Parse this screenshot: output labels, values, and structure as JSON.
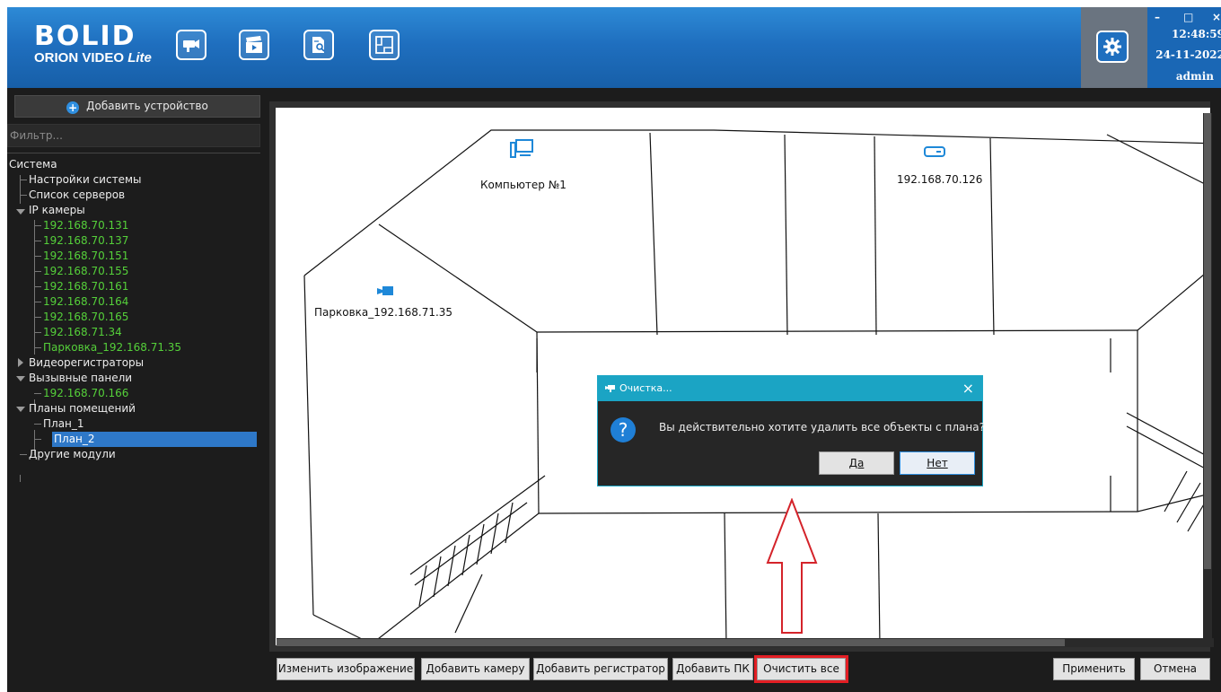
{
  "header": {
    "logo_brand": "BOLID",
    "logo_product": "ORION VIDEO",
    "logo_edition": "Lite",
    "toolbar_icons": [
      "video-camera-icon",
      "playback-clapper-icon",
      "document-search-icon",
      "floor-plan-icon"
    ],
    "settings_icon": "gear-icon",
    "window_controls": {
      "minimize": "–",
      "maximize": "□",
      "close": "×"
    },
    "time": "12:48:59",
    "date": "24-11-2022",
    "user": "admin",
    "accent": "#1f6fbf"
  },
  "sidebar": {
    "add_device_label": "Добавить устройство",
    "filter_placeholder": "Фильтр...",
    "tree": {
      "root": "Система",
      "system_settings": "Настройки системы",
      "server_list": "Список серверов",
      "ip_cameras": {
        "label": "IP камеры",
        "items": [
          "192.168.70.131",
          "192.168.70.137",
          "192.168.70.151",
          "192.168.70.155",
          "192.168.70.161",
          "192.168.70.164",
          "192.168.70.165",
          "192.168.71.34",
          "Парковка_192.168.71.35"
        ]
      },
      "video_recorders": "Видеорегистраторы",
      "call_panels": {
        "label": "Вызывные панели",
        "items": [
          "192.168.70.166"
        ]
      },
      "room_plans": {
        "label": "Планы помещений",
        "items": [
          "План_1",
          "План_2"
        ],
        "selected": "План_2"
      },
      "other_modules": "Другие модули"
    }
  },
  "plan": {
    "objects": {
      "computer": "Компьютер №1",
      "recorder": "192.168.70.126",
      "camera": "Парковка_192.168.71.35"
    }
  },
  "toolbar": {
    "change_image": "Изменить изображение",
    "add_camera": "Добавить камеру",
    "add_recorder": "Добавить регистратор",
    "add_pc": "Добавить ПК",
    "clear_all": "Очистить все",
    "apply": "Применить",
    "cancel": "Отмена"
  },
  "dialog": {
    "title": "Очистка...",
    "message": "Вы действительно хотите удалить все объекты с плана?",
    "yes": "Да",
    "no": "Нет",
    "close": "×",
    "question_mark": "?"
  }
}
